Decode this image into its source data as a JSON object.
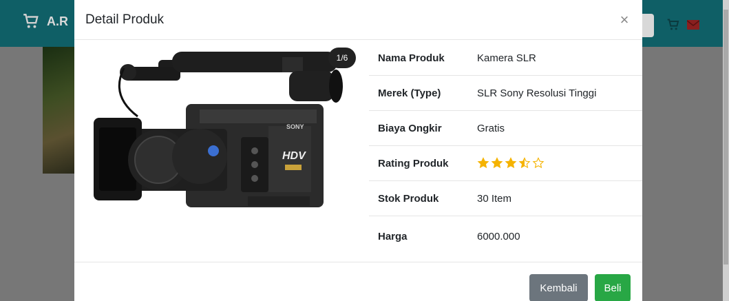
{
  "background": {
    "brand_text": "A.R"
  },
  "modal": {
    "title": "Detail Produk",
    "close_symbol": "×",
    "image_counter": "1/6",
    "details": [
      {
        "label": "Nama Produk",
        "value": "Kamera SLR"
      },
      {
        "label": "Merek (Type)",
        "value": "SLR Sony Resolusi Tinggi"
      },
      {
        "label": "Biaya Ongkir",
        "value": "Gratis"
      },
      {
        "label": "Rating Produk",
        "value": ""
      },
      {
        "label": "Stok Produk",
        "value": "30 Item"
      },
      {
        "label": "Harga",
        "value": "6000.000"
      }
    ],
    "rating": 3.5,
    "rating_max": 5,
    "camera_labels": {
      "brand": "SONY",
      "model": "HDV"
    }
  },
  "footer": {
    "back_label": "Kembali",
    "buy_label": "Beli"
  },
  "colors": {
    "navbar": "#0f5f66",
    "star": "#f5b301",
    "back_button": "#6c757d",
    "buy_button": "#28a745"
  }
}
